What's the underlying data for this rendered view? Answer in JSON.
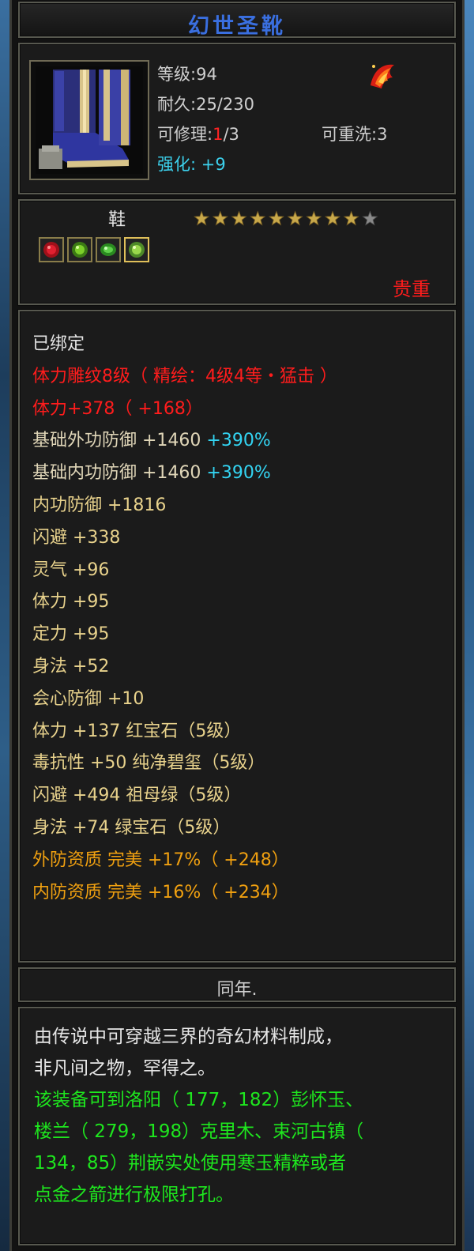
{
  "item": {
    "name": "幻世圣靴",
    "icon": "blue-boots-icon",
    "type": "鞋",
    "stars_filled": 9,
    "stars_total": 10,
    "rarity": "贵重",
    "maker": "同年."
  },
  "stats": {
    "level_label": "等级:",
    "level_value": "94",
    "durability_label": "耐久:",
    "durability_value": "25/230",
    "repair_label": "可修理:",
    "repair_used": "1",
    "repair_max": "/3",
    "rewash_label": "可重洗:",
    "rewash_value": "3",
    "enhance_label": "强化:",
    "enhance_value": "+9"
  },
  "gems": [
    "red-gem-icon",
    "green-gem-icon",
    "emerald-gem-icon",
    "jade-gem-icon"
  ],
  "attributes": [
    {
      "text": "已绑定",
      "color": "white"
    },
    {
      "text": "体力雕纹8级（ 精绘：4级4等・猛击 ）",
      "color": "redline"
    },
    {
      "text": "体力+378（ +168）",
      "color": "redline"
    },
    {
      "text": "基础外功防御 +1460 ",
      "extra": "+390%",
      "color": "beige"
    },
    {
      "text": "基础内功防御 +1460 ",
      "extra": "+390%",
      "color": "beige"
    },
    {
      "text": "内功防御 +1816",
      "color": "yellow"
    },
    {
      "text": "闪避 +338",
      "color": "yellow"
    },
    {
      "text": "灵气 +96",
      "color": "yellow"
    },
    {
      "text": "体力 +95",
      "color": "yellow"
    },
    {
      "text": "定力 +95",
      "color": "yellow"
    },
    {
      "text": "身法 +52",
      "color": "yellow"
    },
    {
      "text": "会心防御 +10",
      "color": "yellow"
    },
    {
      "text": "体力 +137 红宝石（5级）",
      "color": "yellow"
    },
    {
      "text": "毒抗性 +50 纯净碧玺（5级）",
      "color": "yellow"
    },
    {
      "text": "闪避 +494 祖母绿（5级）",
      "color": "yellow"
    },
    {
      "text": "身法 +74 绿宝石（5级）",
      "color": "yellow"
    },
    {
      "text": "外防资质  完美 +17%（ +248）",
      "color": "orange"
    },
    {
      "text": "内防资质  完美 +16%（ +234）",
      "color": "orange"
    }
  ],
  "description": {
    "lines": [
      {
        "text": "由传说中可穿越三界的奇幻材料制成，",
        "color": "white"
      },
      {
        "text": "非凡间之物，罕得之。",
        "color": "white"
      },
      {
        "text": "该装备可到洛阳（ 177，182）彭怀玉、",
        "color": "green"
      },
      {
        "text": "楼兰（ 279，198）克里木、束河古镇（",
        "color": "green"
      },
      {
        "text": "134，85）荆嵌实处使用寒玉精粹或者",
        "color": "green"
      },
      {
        "text": "点金之箭进行极限打孔。",
        "color": "green"
      }
    ]
  }
}
